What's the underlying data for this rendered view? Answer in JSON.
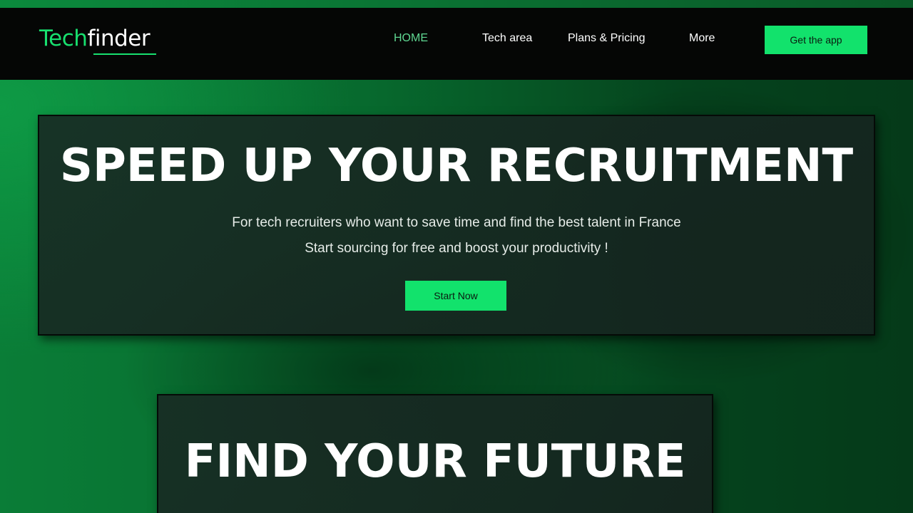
{
  "header": {
    "logo": {
      "part1": "Tech",
      "part2": "finder"
    },
    "nav": [
      {
        "label": "HOME",
        "active": true
      },
      {
        "label": "Tech area",
        "active": false
      },
      {
        "label": "Plans & Pricing",
        "active": false
      },
      {
        "label": "More",
        "active": false
      }
    ],
    "cta_label": "Get the app"
  },
  "hero": {
    "title": "SPEED UP YOUR RECRUITMENT",
    "subtitle1": "For tech recruiters who want to save time and find the best talent in France",
    "subtitle2": "Start sourcing for free and boost your productivity !",
    "button_label": "Start Now"
  },
  "section2": {
    "title": "FIND YOUR FUTURE"
  },
  "colors": {
    "accent": "#12e26c",
    "logo_green": "#18e06f",
    "nav_active": "#5fd691",
    "header_bg": "#050605",
    "card_bg": "#18302a"
  }
}
